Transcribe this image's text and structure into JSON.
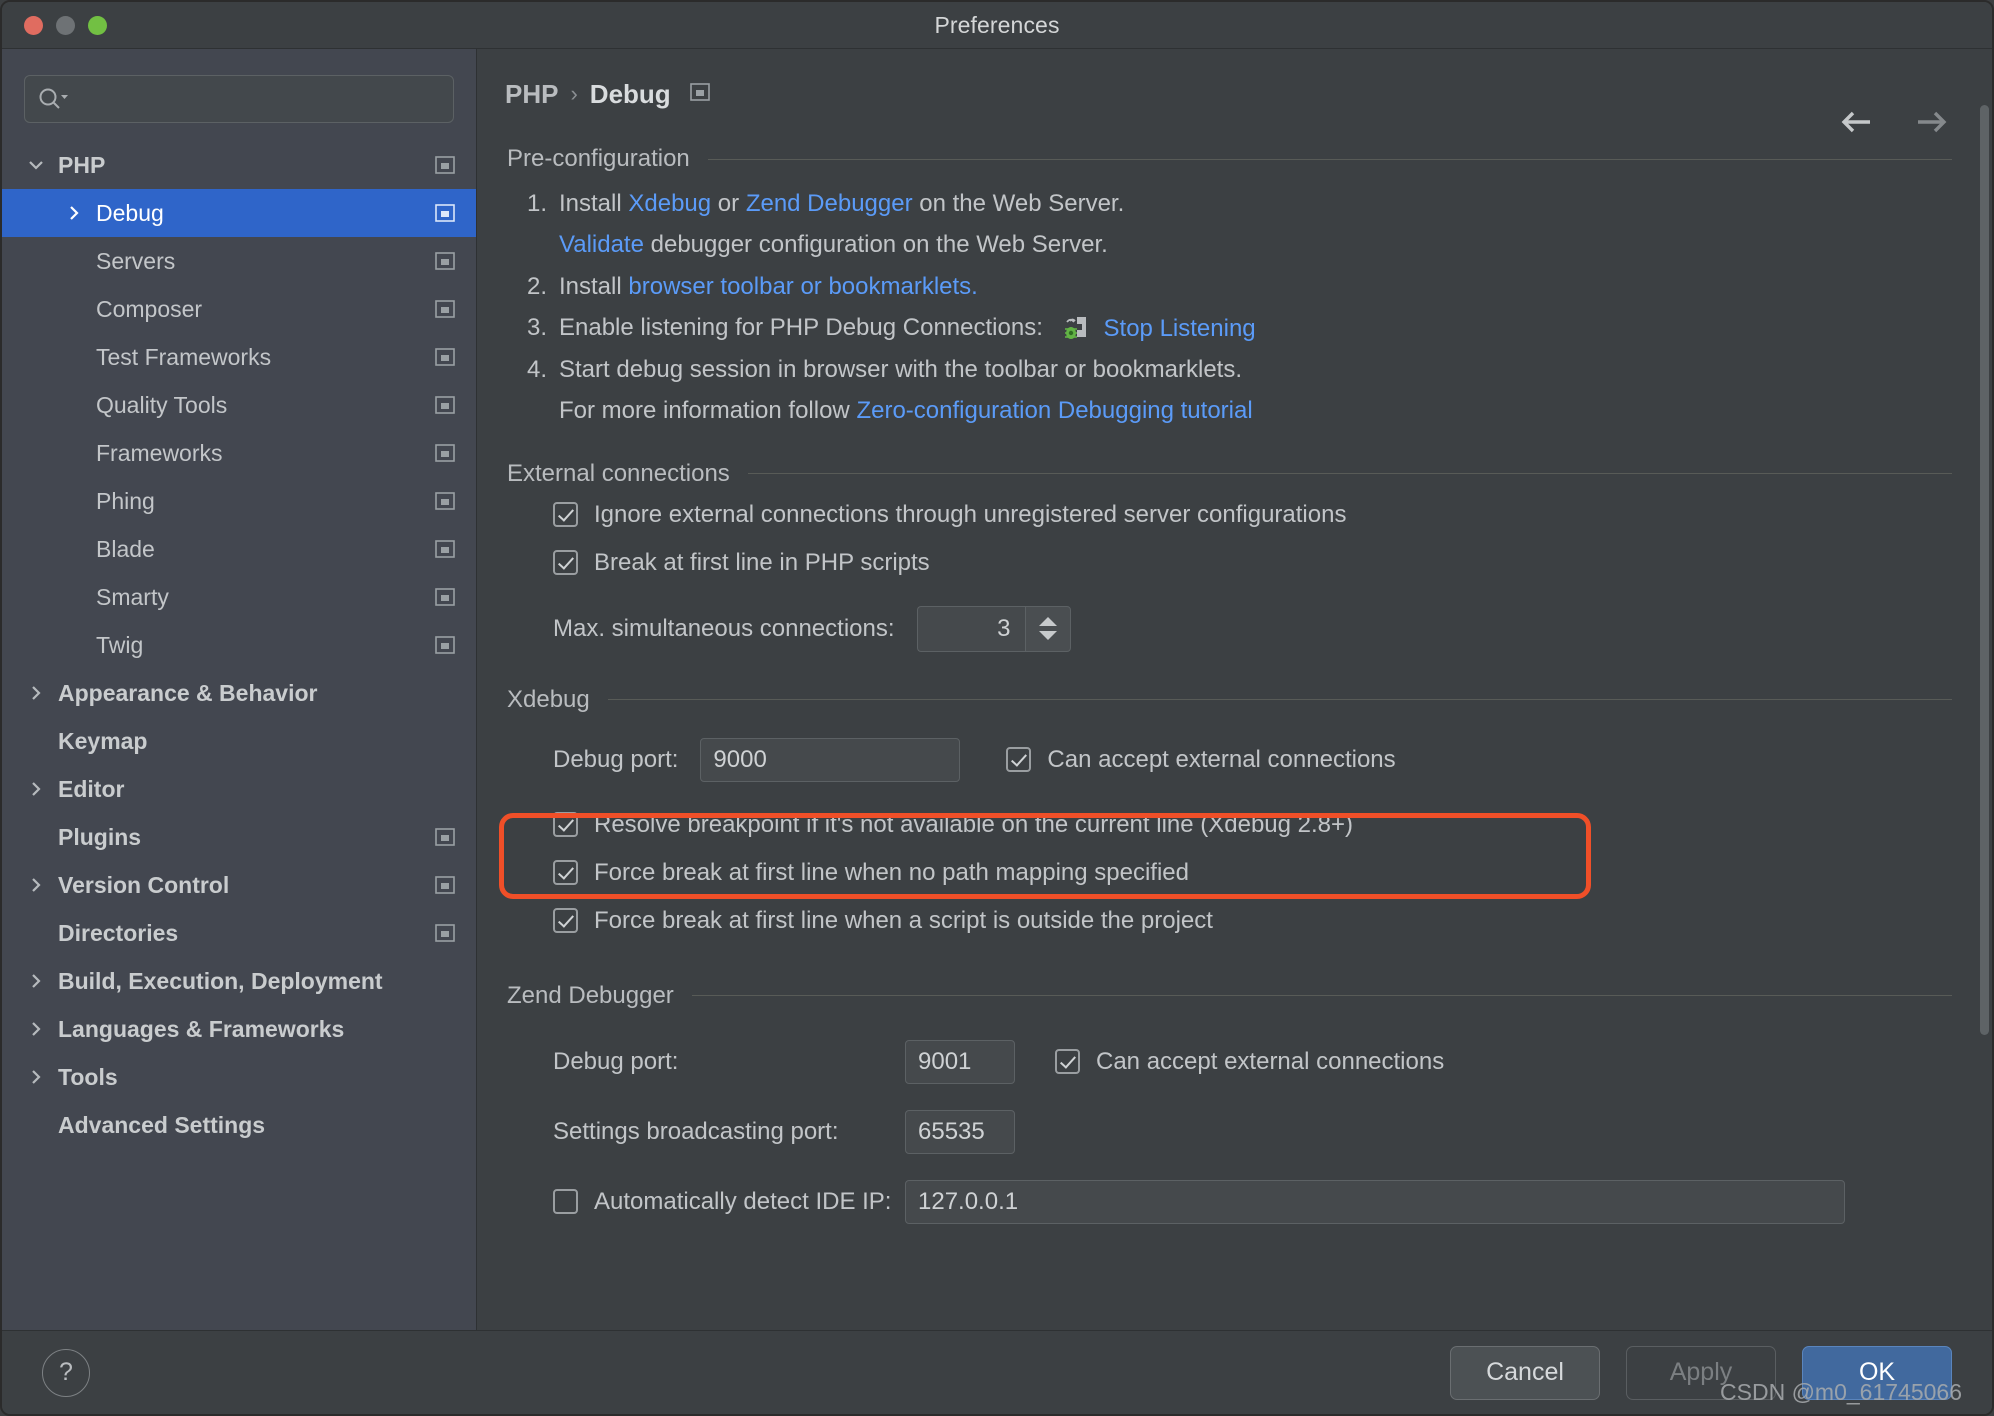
{
  "window": {
    "title": "Preferences",
    "traffic_lights": [
      "close-red",
      "minimize-yellow",
      "maximize-green"
    ]
  },
  "search": {
    "value": "",
    "placeholder": "",
    "icon": "search-icon"
  },
  "sidebar": {
    "items": [
      {
        "label": "PHP",
        "level": 0,
        "arrow": "down",
        "bold": true,
        "selected": false,
        "scope_icon": true
      },
      {
        "label": "Debug",
        "level": 1,
        "arrow": "right",
        "bold": false,
        "selected": true,
        "scope_icon": true
      },
      {
        "label": "Servers",
        "level": 1,
        "arrow": "none",
        "bold": false,
        "selected": false,
        "scope_icon": true
      },
      {
        "label": "Composer",
        "level": 1,
        "arrow": "none",
        "bold": false,
        "selected": false,
        "scope_icon": true
      },
      {
        "label": "Test Frameworks",
        "level": 1,
        "arrow": "none",
        "bold": false,
        "selected": false,
        "scope_icon": true
      },
      {
        "label": "Quality Tools",
        "level": 1,
        "arrow": "none",
        "bold": false,
        "selected": false,
        "scope_icon": true
      },
      {
        "label": "Frameworks",
        "level": 1,
        "arrow": "none",
        "bold": false,
        "selected": false,
        "scope_icon": true
      },
      {
        "label": "Phing",
        "level": 1,
        "arrow": "none",
        "bold": false,
        "selected": false,
        "scope_icon": true
      },
      {
        "label": "Blade",
        "level": 1,
        "arrow": "none",
        "bold": false,
        "selected": false,
        "scope_icon": true
      },
      {
        "label": "Smarty",
        "level": 1,
        "arrow": "none",
        "bold": false,
        "selected": false,
        "scope_icon": true
      },
      {
        "label": "Twig",
        "level": 1,
        "arrow": "none",
        "bold": false,
        "selected": false,
        "scope_icon": true
      },
      {
        "label": "Appearance & Behavior",
        "level": 0,
        "arrow": "right",
        "bold": true,
        "selected": false,
        "scope_icon": false
      },
      {
        "label": "Keymap",
        "level": 0,
        "arrow": "none",
        "bold": true,
        "selected": false,
        "scope_icon": false
      },
      {
        "label": "Editor",
        "level": 0,
        "arrow": "right",
        "bold": true,
        "selected": false,
        "scope_icon": false
      },
      {
        "label": "Plugins",
        "level": 0,
        "arrow": "none",
        "bold": true,
        "selected": false,
        "scope_icon": true
      },
      {
        "label": "Version Control",
        "level": 0,
        "arrow": "right",
        "bold": true,
        "selected": false,
        "scope_icon": true
      },
      {
        "label": "Directories",
        "level": 0,
        "arrow": "none",
        "bold": true,
        "selected": false,
        "scope_icon": true
      },
      {
        "label": "Build, Execution, Deployment",
        "level": 0,
        "arrow": "right",
        "bold": true,
        "selected": false,
        "scope_icon": false
      },
      {
        "label": "Languages & Frameworks",
        "level": 0,
        "arrow": "right",
        "bold": true,
        "selected": false,
        "scope_icon": false
      },
      {
        "label": "Tools",
        "level": 0,
        "arrow": "right",
        "bold": true,
        "selected": false,
        "scope_icon": false
      },
      {
        "label": "Advanced Settings",
        "level": 0,
        "arrow": "none",
        "bold": true,
        "selected": false,
        "scope_icon": false
      }
    ]
  },
  "breadcrumb": {
    "root": "PHP",
    "separator": "›",
    "current": "Debug",
    "scope_icon": "project-scope-icon"
  },
  "nav": {
    "back_icon": "arrow-left-icon",
    "forward_icon": "arrow-right-icon"
  },
  "preconfiguration": {
    "title": "Pre-configuration",
    "step1": {
      "num": "1.",
      "a": "Install ",
      "link1": "Xdebug",
      "b": " or ",
      "link2": "Zend Debugger",
      "c": " on the Web Server."
    },
    "step1_sub": {
      "link": "Validate",
      "rest": " debugger configuration on the Web Server."
    },
    "step2": {
      "num": "2.",
      "a": "Install ",
      "link": "browser toolbar or bookmarklets."
    },
    "step3": {
      "num": "3.",
      "a": "Enable listening for PHP Debug Connections:",
      "link": "Stop Listening",
      "icon": "listening-bug-phone-icon"
    },
    "step4": {
      "num": "4.",
      "a": "Start debug session in browser with the toolbar or bookmarklets."
    },
    "step4_sub": {
      "a": "For more information follow ",
      "link": "Zero-configuration Debugging tutorial"
    }
  },
  "external_connections": {
    "title": "External connections",
    "ignore_external": {
      "label": "Ignore external connections through unregistered server configurations",
      "checked": true
    },
    "break_first_line": {
      "label": "Break at first line in PHP scripts",
      "checked": true
    },
    "max_connections": {
      "label": "Max. simultaneous connections:",
      "value": "3"
    }
  },
  "xdebug": {
    "title": "Xdebug",
    "debug_port": {
      "label": "Debug port:",
      "value": "9000"
    },
    "can_accept": {
      "label": "Can accept external connections",
      "checked": true
    },
    "resolve_breakpoint": {
      "label": "Resolve breakpoint if it's not available on the current line (Xdebug 2.8+)",
      "checked": true
    },
    "force_break_no_mapping": {
      "label": "Force break at first line when no path mapping specified",
      "checked": true
    },
    "force_break_outside": {
      "label": "Force break at first line when a script is outside the project",
      "checked": true
    }
  },
  "zend_debugger": {
    "title": "Zend Debugger",
    "debug_port": {
      "label": "Debug port:",
      "value": "9001"
    },
    "can_accept": {
      "label": "Can accept external connections",
      "checked": true
    },
    "broadcast_port": {
      "label": "Settings broadcasting port:",
      "value": "65535"
    },
    "auto_detect_ip": {
      "label": "Automatically detect IDE IP:",
      "checked": false,
      "value": "127.0.0.1"
    }
  },
  "footer": {
    "help_label": "?",
    "cancel_label": "Cancel",
    "apply_label": "Apply",
    "ok_label": "OK",
    "watermark": "CSDN @m0_61745066"
  },
  "colors": {
    "accent_blue": "#2f65c9",
    "link_blue": "#5b9bf8",
    "annotation_red": "#f04f28",
    "primary_button": "#41699e",
    "bug_green": "#62b345"
  }
}
